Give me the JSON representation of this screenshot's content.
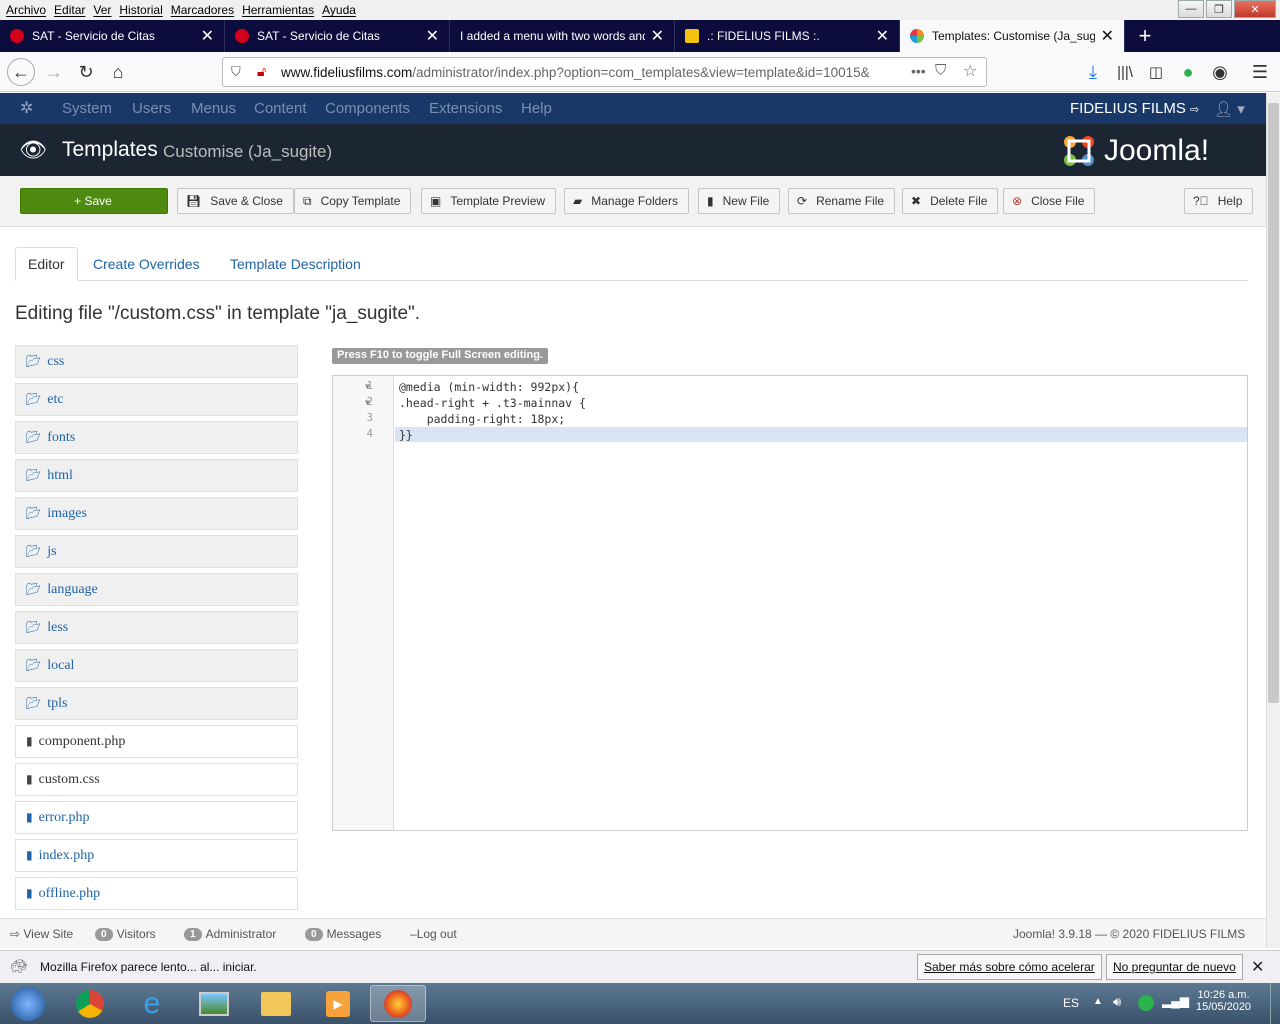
{
  "window_menu": [
    "Archivo",
    "Editar",
    "Ver",
    "Historial",
    "Marcadores",
    "Herramientas",
    "Ayuda"
  ],
  "browser_tabs": [
    {
      "title": "SAT - Servicio de Citas",
      "favicon_color": "#d4001a"
    },
    {
      "title": "SAT - Servicio de Citas",
      "favicon_color": "#d4001a"
    },
    {
      "title": "I added a menu with two words and",
      "favicon_color": ""
    },
    {
      "title": ".: FIDELIUS FILMS :.",
      "favicon_color": "#f4c20d"
    },
    {
      "title": "Templates: Customise (Ja_sugite",
      "favicon_color": "#f28d1a"
    }
  ],
  "url": {
    "domain": "www.fideliusfilms.com",
    "path": "/administrator/index.php?option=com_templates&view=template&id=10015&"
  },
  "admin_menu": [
    "System",
    "Users",
    "Menus",
    "Content",
    "Components",
    "Extensions",
    "Help"
  ],
  "site_name": "FIDELIUS FILMS",
  "header": {
    "title": "Templates",
    "subtitle": "Customise (Ja_sugite)",
    "logo_text": "Joomla!"
  },
  "toolbar": {
    "save": "+ Save",
    "save_close": "Save & Close",
    "copy_template": "Copy Template",
    "template_preview": "Template Preview",
    "manage_folders": "Manage Folders",
    "new_file": "New File",
    "rename_file": "Rename File",
    "delete_file": "Delete File",
    "close_file": "Close File",
    "help": "Help"
  },
  "tabs": [
    "Editor",
    "Create Overrides",
    "Template Description"
  ],
  "editing_heading": "Editing file \"/custom.css\" in template \"ja_sugite\".",
  "folders": [
    "css",
    "etc",
    "fonts",
    "html",
    "images",
    "js",
    "language",
    "less",
    "local",
    "tpls"
  ],
  "files": [
    {
      "name": "component.php",
      "linked": false
    },
    {
      "name": "custom.css",
      "linked": false
    },
    {
      "name": "error.php",
      "linked": true
    },
    {
      "name": "index.php",
      "linked": true
    },
    {
      "name": "offline.php",
      "linked": true
    }
  ],
  "f10_hint": "Press F10 to toggle Full Screen editing.",
  "code_lines": [
    "@media (min-width: 992px){",
    ".head-right + .t3-mainnav {",
    "    padding-right: 18px;",
    "}}"
  ],
  "line_numbers": [
    "1",
    "2",
    "3",
    "4"
  ],
  "status": {
    "view_site": "View Site",
    "visitors_count": "0",
    "visitors": "Visitors",
    "admin_count": "1",
    "admin": "Administrator",
    "messages_count": "0",
    "messages": "Messages",
    "logout": "Log out",
    "version": "Joomla! 3.9.18 — © 2020 FIDELIUS FILMS"
  },
  "notification": {
    "text": "Mozilla Firefox parece lento... al... iniciar.",
    "learn": "Saber más sobre cómo acelerar",
    "dismiss": "No preguntar de nuevo"
  },
  "taskbar": {
    "lang": "ES",
    "time": "10:26 a.m.",
    "date": "15/05/2020"
  }
}
